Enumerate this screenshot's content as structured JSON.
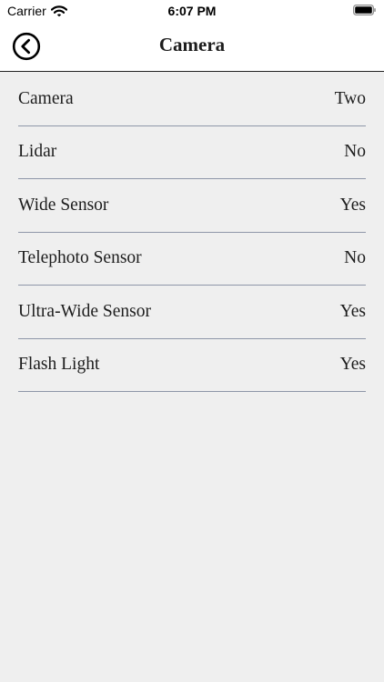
{
  "status_bar": {
    "carrier": "Carrier",
    "time": "6:07 PM",
    "wifi_icon": "wifi-icon",
    "battery_icon": "battery-icon"
  },
  "nav": {
    "title": "Camera",
    "back_icon": "chevron-left-circle-icon"
  },
  "rows": [
    {
      "label": "Camera",
      "value": "Two"
    },
    {
      "label": "Lidar",
      "value": "No"
    },
    {
      "label": "Wide Sensor",
      "value": "Yes"
    },
    {
      "label": "Telephoto Sensor",
      "value": "No"
    },
    {
      "label": "Ultra-Wide Sensor",
      "value": "Yes"
    },
    {
      "label": "Flash Light",
      "value": "Yes"
    }
  ],
  "colors": {
    "background": "#efefef",
    "header_bg": "#ffffff",
    "divider": "#8e96a8"
  }
}
